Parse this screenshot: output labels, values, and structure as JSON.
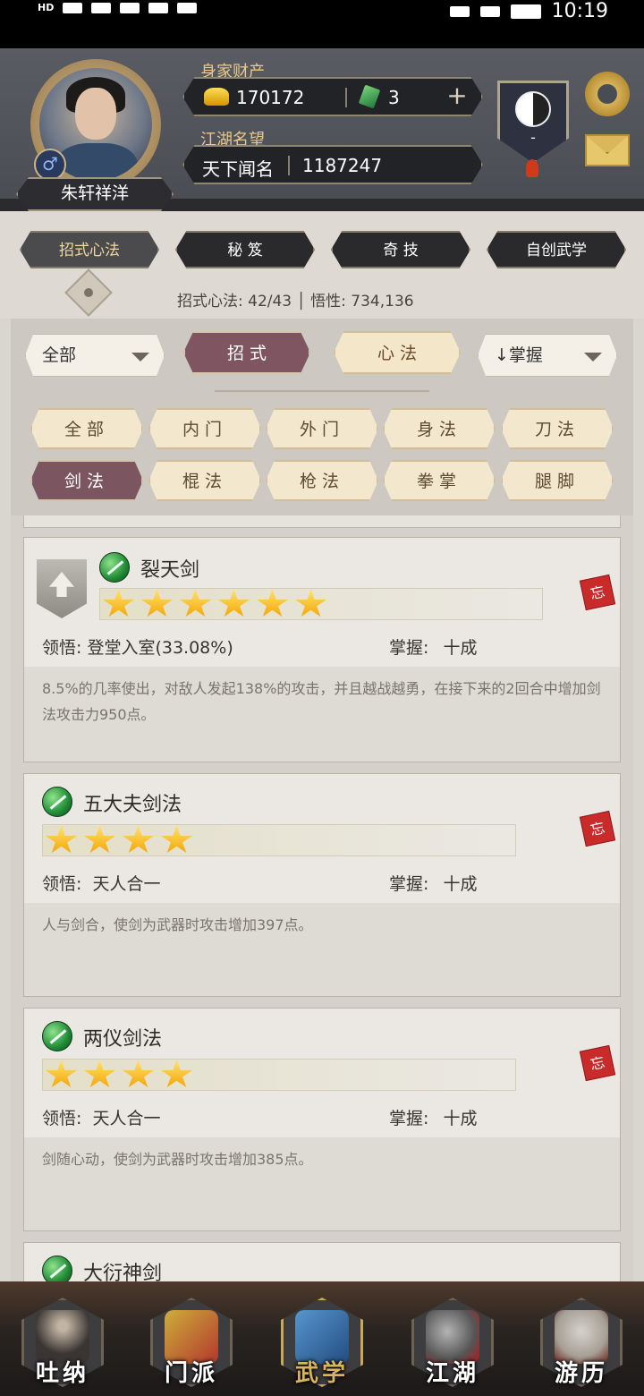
{
  "status_bar": {
    "left": "HD",
    "time": "10:19"
  },
  "header": {
    "player_name": "朱轩祥洋",
    "wealth_label": "身家财产",
    "gold": "170172",
    "jade": "3",
    "fame_label": "江湖名望",
    "fame_title": "天下闻名",
    "fame_value": "1187247",
    "banner_text": "-"
  },
  "tabs": [
    "招式心法",
    "秘 笈",
    "奇 技",
    "自创武学"
  ],
  "stats": {
    "text": "招式心法: 42/43 │ 悟性: 734,136"
  },
  "filters": {
    "category_dropdown": "全部",
    "type_active": "招 式",
    "type_inactive": "心 法",
    "sort_dropdown": "↓掌握",
    "chips": [
      "全部",
      "内门",
      "外门",
      "身法",
      "刀法",
      "剑法",
      "棍法",
      "枪法",
      "拳掌",
      "腿脚"
    ],
    "active_chip": "剑法"
  },
  "skills": [
    {
      "name": "裂天剑",
      "stars": 6,
      "comprehension_label": "领悟:",
      "comprehension": "登堂入室(33.08%)",
      "mastery_label": "掌握:",
      "mastery": "十成",
      "desc": "8.5%的几率使出，对敌人发起138%的攻击，并且越战越勇，在接下来的2回合中增加剑法攻击力950点。",
      "forget": "忘"
    },
    {
      "name": "五大夫剑法",
      "stars": 4,
      "comprehension_label": "领悟:",
      "comprehension": "天人合一",
      "mastery_label": "掌握:",
      "mastery": "十成",
      "desc": "人与剑合，使剑为武器时攻击增加397点。",
      "forget": "忘"
    },
    {
      "name": "两仪剑法",
      "stars": 4,
      "comprehension_label": "领悟:",
      "comprehension": "天人合一",
      "mastery_label": "掌握:",
      "mastery": "十成",
      "desc": "剑随心动，使剑为武器时攻击增加385点。",
      "forget": "忘"
    },
    {
      "name": "大衍神剑"
    }
  ],
  "bottom_nav": [
    "吐纳",
    "门派",
    "武学",
    "江湖",
    "游历"
  ],
  "colors": {
    "accent": "#7b5661",
    "gold": "#e8c98a",
    "header": "#4a4c53"
  }
}
